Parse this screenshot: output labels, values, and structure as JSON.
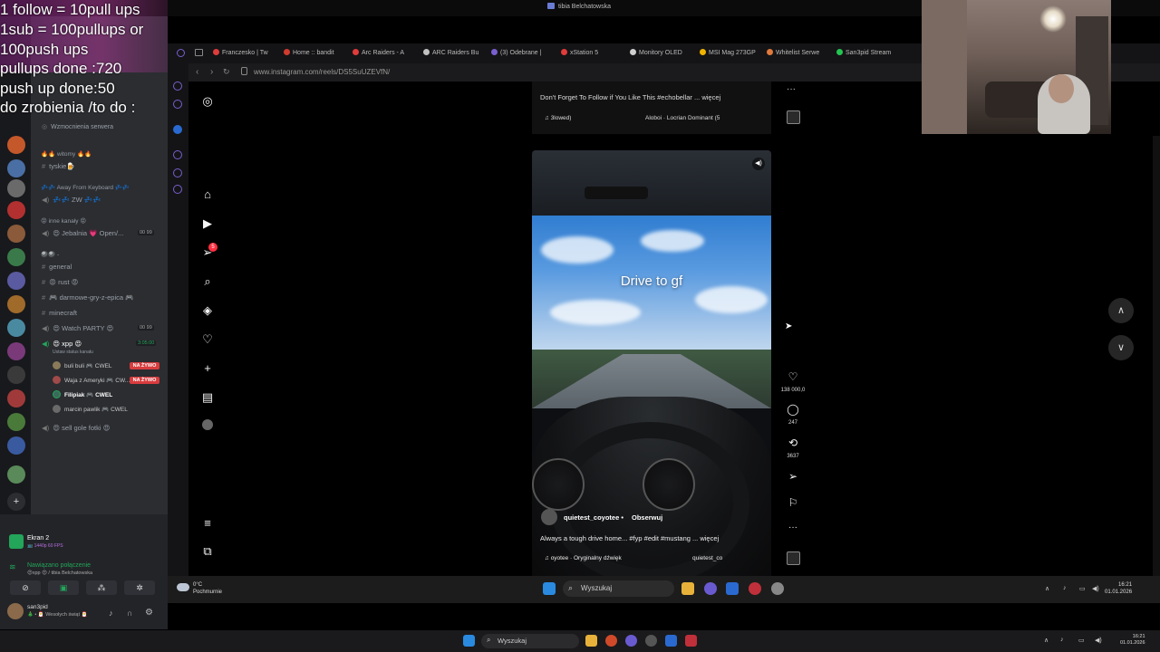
{
  "window": {
    "title": "tibia Belchatowska"
  },
  "overlay": {
    "lines": [
      "1 follow = 10pull ups",
      "1sub = 100pullups or",
      "100push ups",
      "pullups done :720",
      "push up done:50",
      "do zrobienia /to do :"
    ]
  },
  "browser": {
    "tabs": [
      {
        "label": "Franczesko | Tw",
        "color": "#e03c3c"
      },
      {
        "label": "Home :: bandit",
        "color": "#d23b2f"
      },
      {
        "label": "Arc Raiders - A",
        "color": "#e23b3b"
      },
      {
        "label": "ARC Raiders Bu",
        "color": "#c1c1c1"
      },
      {
        "label": "(3) Odebrane |",
        "color": "#7a5fd0"
      },
      {
        "label": "xStation 5",
        "color": "#e23b3b"
      },
      {
        "label": "Monitory OLED",
        "color": "#cfcfcf"
      },
      {
        "label": "MSI Mag 273GP",
        "color": "#f0b400"
      },
      {
        "label": "Whitelist Serwe",
        "color": "#e07a3c"
      },
      {
        "label": "San3pid Stream",
        "color": "#23c552"
      }
    ],
    "url": "www.instagram.com/reels/DS5SuUZEVfN/"
  },
  "discord": {
    "server_name": "Wzmocnienia serwera",
    "categories": [
      {
        "name": "🔥🔥 witomy 🔥🔥",
        "channels": [
          {
            "type": "text",
            "name": "tyskie🍺"
          }
        ]
      },
      {
        "name": "💤💤 Away From Keyboard 💤💤",
        "channels": [
          {
            "type": "voice",
            "name": "💤💤 ZW 💤💤"
          }
        ]
      },
      {
        "name": "😡 inne kanały 😡",
        "channels": [
          {
            "type": "voice",
            "name": "😍 Jebalnia 💗 Open/...",
            "count": "00 99"
          }
        ]
      },
      {
        "name": "🎱🎱 -",
        "channels": [
          {
            "type": "text",
            "name": "general"
          },
          {
            "type": "text",
            "name": "😡 rust 😡"
          },
          {
            "type": "text",
            "name": "🎮 darmowe-gry-z-epica 🎮"
          },
          {
            "type": "text",
            "name": "minecraft"
          },
          {
            "type": "voice",
            "name": "😍 Watch PARTY 😍",
            "count": "00 99"
          },
          {
            "type": "voice",
            "name": "😍 xpp 😍",
            "time": "3:05:00",
            "status": "Ustaw status kanału"
          }
        ]
      },
      {
        "name": "",
        "channels": [
          {
            "type": "voice",
            "name": "😍 sell gole fotki 😍"
          }
        ]
      }
    ],
    "voice_users": [
      {
        "name": "buli buli 🎮 CWEL",
        "live": "NA ŻYWO"
      },
      {
        "name": "Waja z Ameryki 🎮 CW...",
        "live": "NA ŻYWO"
      },
      {
        "name": "Filipiak 🎮 CWEL",
        "live": ""
      },
      {
        "name": "marcin pawlik 🎮 CWEL",
        "live": ""
      }
    ],
    "stream_title": "Ekran 2",
    "stream_sub": "📺 1440p 60 FPS",
    "connection_status": "Nawiązano połączenie",
    "connection_detail": "😍xpp 😍 / tibia Belchatowska",
    "username": "san3pid",
    "user_status": "🎄 • 🎅 Wesołych świąt 🎅"
  },
  "instagram": {
    "prev_reel": {
      "caption": "Don't Forget To Follow if You Like This #echobellar ... więcej",
      "audio": "3lowed)",
      "audio2": "Aloboi · Locrian Dominant (5"
    },
    "reel": {
      "overlay_text": "Drive to gf",
      "author": "quietest_coyotee",
      "separator": "•",
      "follow": "Obserwuj",
      "caption": "Always a tough drive home... #fyp #edit #mustang ... więcej",
      "audio": "oyotee · Oryginalny dźwięk",
      "audio2": "quietest_co"
    },
    "likes": "138 000,0",
    "comments": "247",
    "reposts": "3637",
    "notifications_badge": "5"
  },
  "inner_taskbar": {
    "weather_temp": "0°C",
    "weather_desc": "Pochmurnie",
    "search": "Wyszukaj",
    "time": "16:21",
    "date": "01.01.2026"
  },
  "outer_taskbar": {
    "search": "Wyszukaj",
    "time": "16:21",
    "date": "01.01.2026"
  }
}
